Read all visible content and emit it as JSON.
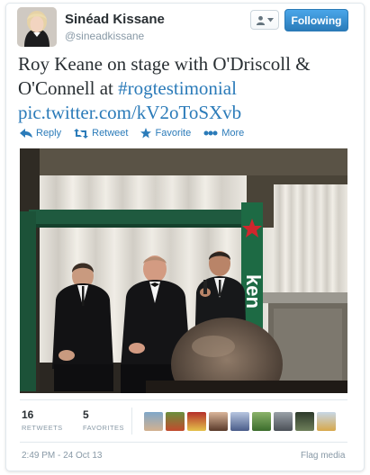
{
  "profile": {
    "name": "Sinéad Kissane",
    "handle": "@sineadkissane",
    "follow_label": "Following"
  },
  "tweet": {
    "text_line1": "Roy Keane on stage with O'Driscoll &",
    "text_line2_plain": "O'Connell at ",
    "hashtag": "#rogtestimonial",
    "pic_link": "pic.twitter.com/kV2oToSXvb"
  },
  "actions": {
    "reply": "Reply",
    "retweet": "Retweet",
    "favorite": "Favorite",
    "more": "More"
  },
  "media": {
    "sign_text": "ken"
  },
  "stats": {
    "retweets_count": "16",
    "retweets_label": "RETWEETS",
    "favorites_count": "5",
    "favorites_label": "FAVORITES"
  },
  "footer": {
    "timestamp": "2:49 PM - 24 Oct 13",
    "flag_label": "Flag media"
  },
  "colors": {
    "link": "#2b7bb9",
    "follow_button": "#2b7bb9",
    "muted": "#8899a6"
  }
}
